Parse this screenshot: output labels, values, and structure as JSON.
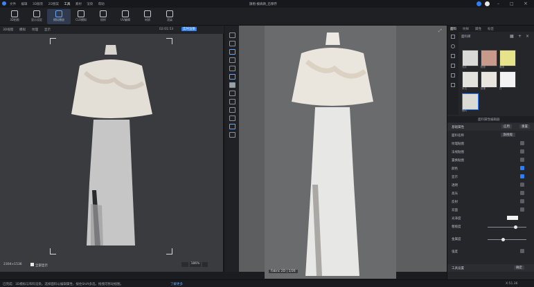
{
  "titlebar": {
    "menu": [
      "文件",
      "编辑",
      "3D服装",
      "2D图案",
      "工具",
      "素材",
      "渲染",
      "帮助"
    ],
    "doc_title": "旗袍-披肩款_已保存"
  },
  "toolbar": {
    "tools": [
      {
        "label": "3D拍照",
        "icon": "camera-icon"
      },
      {
        "label": "显示设定",
        "icon": "display-icon"
      },
      {
        "label": "模拟播放",
        "icon": "play-icon"
      },
      {
        "label": "CLO模拟",
        "icon": "simulate-icon"
      },
      {
        "label": "纹样",
        "icon": "pattern-icon"
      },
      {
        "label": "UV编辑",
        "icon": "uv-icon"
      },
      {
        "label": "材质",
        "icon": "material-icon"
      },
      {
        "label": "渲染",
        "icon": "render-icon"
      }
    ],
    "active_index": 2
  },
  "left_panel": {
    "head_items": [
      "3D视窗",
      "模拟",
      "纹理",
      "显示"
    ],
    "fps_label": "02:01:53",
    "fps_badge": "实时渲染",
    "bottom_info": "2304×1536",
    "bottom_action": "全部显示",
    "zoom_value": "186%"
  },
  "canvas2d": {
    "caption": "Fabric 2D | 1/26 ",
    "zoom": "100%"
  },
  "right_panel": {
    "tabs": [
      "面料",
      "纹样",
      "属性",
      "标签"
    ],
    "library_label": "面料库",
    "swatches": [
      {
        "label": "浅灰",
        "color": "#d9d9d7"
      },
      {
        "label": "粉棕",
        "color": "#c89a8c"
      },
      {
        "label": "黄绿",
        "color": "#e6e38a"
      },
      {
        "label": "米白",
        "color": "#e4e2dc"
      },
      {
        "label": "纹理",
        "color": "#e8e6df"
      },
      {
        "label": "白",
        "color": "#f3f3f3"
      },
      {
        "label": "面料",
        "color": "#dcdad5"
      }
    ],
    "props_header": "面料属性编辑器",
    "section_title": "基础属性",
    "section_action": "应用",
    "section_action2": "重置",
    "rows": [
      {
        "k": "面料名称",
        "v": "旗袍缎"
      },
      {
        "k": "纹理贴图",
        "v": ""
      },
      {
        "k": "法线贴图",
        "v": ""
      },
      {
        "k": "置换贴图",
        "v": ""
      },
      {
        "k": "颜色",
        "v": ""
      },
      {
        "k": "显示",
        "v": ""
      },
      {
        "k": "透明",
        "v": ""
      },
      {
        "k": "高光",
        "v": ""
      },
      {
        "k": "反射",
        "v": ""
      },
      {
        "k": "双面",
        "v": ""
      },
      {
        "k": "光泽度",
        "v": ""
      },
      {
        "k": "粗糙度",
        "v": ""
      },
      {
        "k": "金属度",
        "v": ""
      },
      {
        "k": "强度",
        "v": ""
      }
    ],
    "checked": [
      false,
      false,
      false,
      false,
      true,
      true,
      false,
      false,
      false,
      false,
      false,
      false,
      false,
      false
    ],
    "slider_values": {
      "light": 0.4,
      "rough": 0.6,
      "strength": 0.35
    },
    "footer_label": "工具设置",
    "footer_btn": "确定"
  },
  "status": {
    "text": "已完成：3D模拟与布料渲染。选择面料以编辑属性，按住Shift多选，拖拽可移动视图。",
    "link": "了解更多",
    "coords": "X:51.36"
  }
}
